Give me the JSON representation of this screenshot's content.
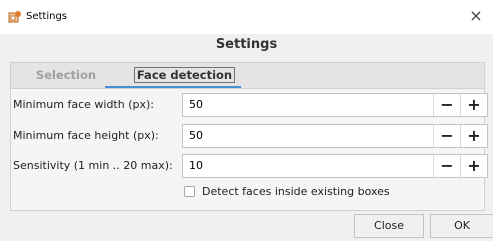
{
  "window": {
    "title": "Settings",
    "close_glyph": "×",
    "app_icon": "settings-app-icon"
  },
  "dialog": {
    "header": "Settings"
  },
  "tabs": [
    {
      "label": "Selection",
      "active": false
    },
    {
      "label": "Face detection",
      "active": true
    }
  ],
  "fields": [
    {
      "label": "Minimum face width (px):",
      "value": "50"
    },
    {
      "label": "Minimum face height (px):",
      "value": "50"
    },
    {
      "label": "Sensitivity (1 min .. 20 max):",
      "value": "10"
    }
  ],
  "spin_buttons": {
    "minus": "−",
    "plus": "+"
  },
  "checkbox": {
    "label": "Detect faces inside existing boxes",
    "checked": false
  },
  "buttons": {
    "close": "Close",
    "ok": "OK"
  },
  "colors": {
    "accent": "#4a8fd6"
  }
}
